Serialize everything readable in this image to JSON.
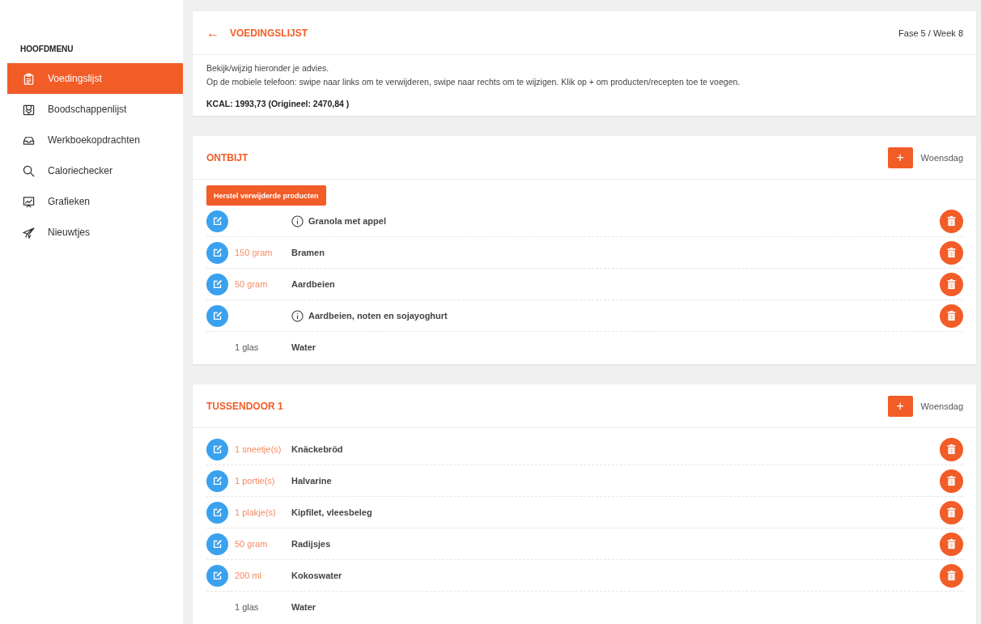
{
  "sidebar": {
    "heading": "HOOFDMENU",
    "items": [
      {
        "label": "Voedingslijst",
        "selected": true
      },
      {
        "label": "Boodschappenlijst",
        "selected": false
      },
      {
        "label": "Werkboekopdrachten",
        "selected": false
      },
      {
        "label": "Caloriechecker",
        "selected": false
      },
      {
        "label": "Grafieken",
        "selected": false
      },
      {
        "label": "Nieuwtjes",
        "selected": false
      }
    ]
  },
  "header": {
    "back": "←",
    "title": "VOEDINGSLIJST",
    "phase": "Fase 5 / Week 8",
    "lines": [
      "Bekijk/wijzig hieronder je advies.",
      "Op de mobiele telefoon: swipe naar links om te verwijderen, swipe naar rechts om te wijzigen. Klik op + om producten/recepten toe te voegen."
    ],
    "kcal": "KCAL: 1993,73 (Origineel: 2470,84 )"
  },
  "meals": [
    {
      "title": "ONTBIJT",
      "add": "+",
      "day": "Woensdag",
      "restore": "Herstel verwijderde producten",
      "items": [
        {
          "kind": "recipe",
          "name": "Granola met appel"
        },
        {
          "kind": "product",
          "amount": "150 gram",
          "name": "Bramen"
        },
        {
          "kind": "product",
          "amount": "50 gram",
          "name": "Aardbeien"
        },
        {
          "kind": "recipe",
          "name": "Aardbeien, noten en sojayoghurt"
        },
        {
          "kind": "fixed",
          "amount": "1 glas",
          "name": "Water"
        }
      ]
    },
    {
      "title": "TUSSENDOOR 1",
      "add": "+",
      "day": "Woensdag",
      "items": [
        {
          "kind": "product",
          "amount": "1 sneetje(s)",
          "name": "Knäckebröd"
        },
        {
          "kind": "product",
          "amount": "1 portie(s)",
          "name": "Halvarine"
        },
        {
          "kind": "product",
          "amount": "1 plakje(s)",
          "name": "Kipfilet, vleesbeleg"
        },
        {
          "kind": "product",
          "amount": "50 gram",
          "name": "Radijsjes"
        },
        {
          "kind": "product",
          "amount": "200 ml",
          "name": "Kokoswater"
        },
        {
          "kind": "fixed",
          "amount": "1 glas",
          "name": "Water"
        }
      ]
    }
  ]
}
